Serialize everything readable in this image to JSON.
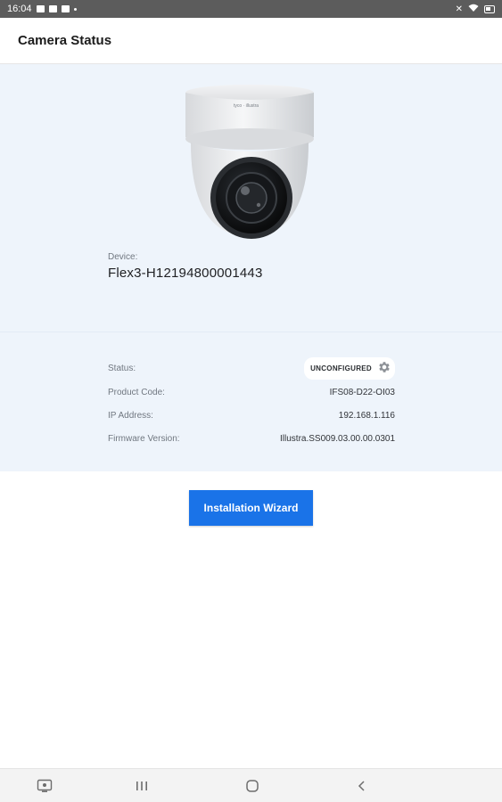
{
  "status_bar": {
    "time": "16:04"
  },
  "header": {
    "title": "Camera Status"
  },
  "device": {
    "label": "Device:",
    "name": "Flex3-H12194800001443"
  },
  "details": {
    "status_label": "Status:",
    "status_value": "UNCONFIGURED",
    "product_code_label": "Product Code:",
    "product_code_value": "IFS08-D22-OI03",
    "ip_label": "IP Address:",
    "ip_value": "192.168.1.116",
    "firmware_label": "Firmware Version:",
    "firmware_value": "Illustra.SS009.03.00.00.0301"
  },
  "actions": {
    "wizard_label": "Installation Wizard"
  },
  "colors": {
    "accent": "#1a73e8",
    "panel_bg": "#eef4fb"
  },
  "icons": {
    "settings": "gear-icon",
    "nav_recent": "recent-apps-icon",
    "nav_home": "home-icon",
    "nav_back": "back-icon"
  }
}
